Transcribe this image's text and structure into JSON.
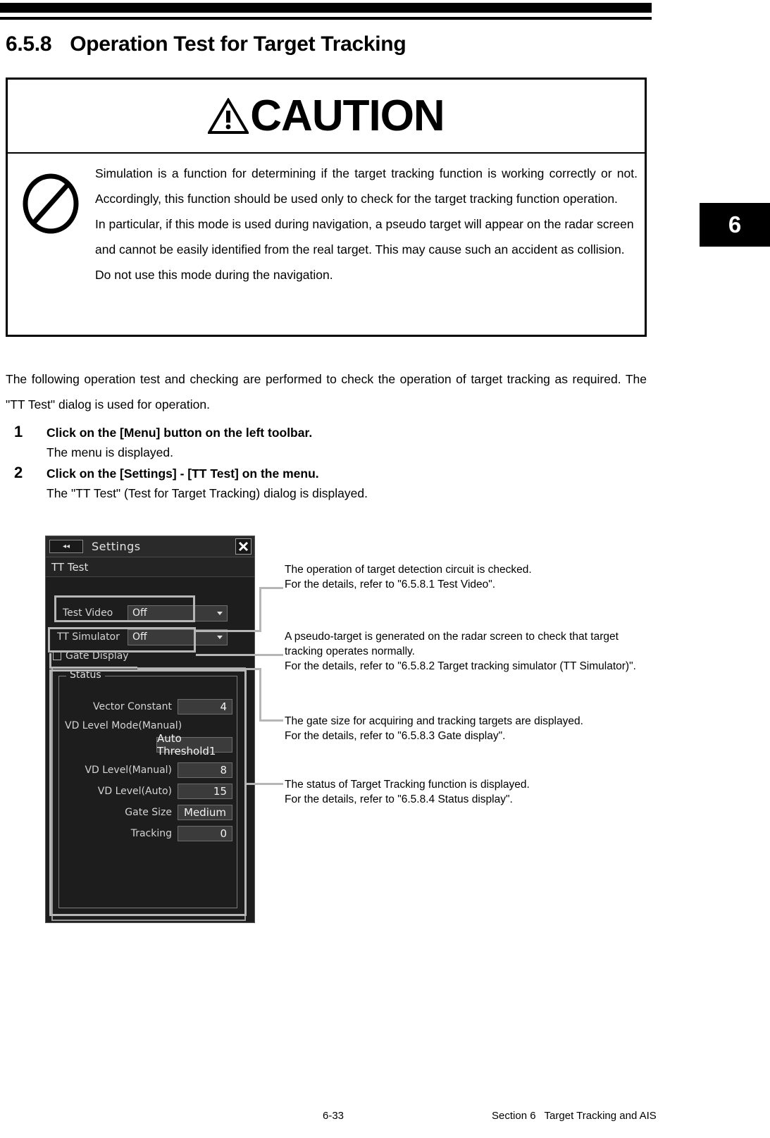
{
  "header": {
    "section_number": "6.5.8",
    "title": "Operation Test for Target Tracking",
    "chapter_tab": "6"
  },
  "caution": {
    "label": "CAUTION",
    "icon": "prohibition-icon",
    "paragraph1": "Simulation is a function for determining if the target tracking function is working correctly or not. Accordingly, this function should be used only to check for the target tracking function operation.",
    "paragraph2": "In particular, if this mode is used during navigation, a pseudo target will appear on the radar screen and cannot be easily identified from the real target. This may cause such an accident as collision. Do not use this mode during the navigation."
  },
  "intro": "The following operation test and checking are performed to check the operation of target tracking as required. The \"TT Test\" dialog is used for operation.",
  "steps": [
    {
      "number": "1",
      "title": "Click on the [Menu] button on the left toolbar.",
      "result": "The menu is displayed."
    },
    {
      "number": "2",
      "title": "Click on the [Settings] - [TT Test] on the menu.",
      "result": "The \"TT Test\" (Test for Target Tracking) dialog is displayed."
    }
  ],
  "dialog": {
    "back_button": "◂◂",
    "title": "Settings",
    "close_button": "✕",
    "section_label": "TT Test",
    "test_video": {
      "label": "Test Video",
      "value": "Off"
    },
    "tt_simulator": {
      "label": "TT Simulator",
      "value": "Off"
    },
    "gate_display": {
      "label": "Gate Display",
      "checked": false
    },
    "status": {
      "legend": "Status",
      "rows": [
        {
          "label": "Vector Constant",
          "value": "4"
        },
        {
          "label": "VD Level Mode(Manual)",
          "value": "Auto Threshold1"
        },
        {
          "label": "VD Level(Manual)",
          "value": "8"
        },
        {
          "label": "VD Level(Auto)",
          "value": "15"
        },
        {
          "label": "Gate Size",
          "value": "Medium"
        },
        {
          "label": "Tracking",
          "value": "0"
        }
      ]
    }
  },
  "callouts": [
    {
      "line1": "The operation of target detection circuit is checked.",
      "line2": "For the details, refer to \"6.5.8.1 Test Video\"."
    },
    {
      "line1": "A pseudo-target is generated on the radar screen to check that target tracking operates normally.",
      "line2": "For the details, refer to \"6.5.8.2 Target tracking simulator (TT Simulator)\"."
    },
    {
      "line1": "The gate size for acquiring and tracking targets are displayed.",
      "line2": "For the details, refer to \"6.5.8.3 Gate display\"."
    },
    {
      "line1": "The status of Target Tracking function is displayed.",
      "line2": "For the details, refer to \"6.5.8.4 Status display\"."
    }
  ],
  "footer": {
    "page_number": "6-33",
    "section_label": "Section 6",
    "section_title": "Target Tracking and AIS"
  },
  "colors": {
    "annotation_gray": "#b6b6b6",
    "dialog_bg": "#1d1d1d",
    "dialog_text": "#d8d8d8"
  }
}
